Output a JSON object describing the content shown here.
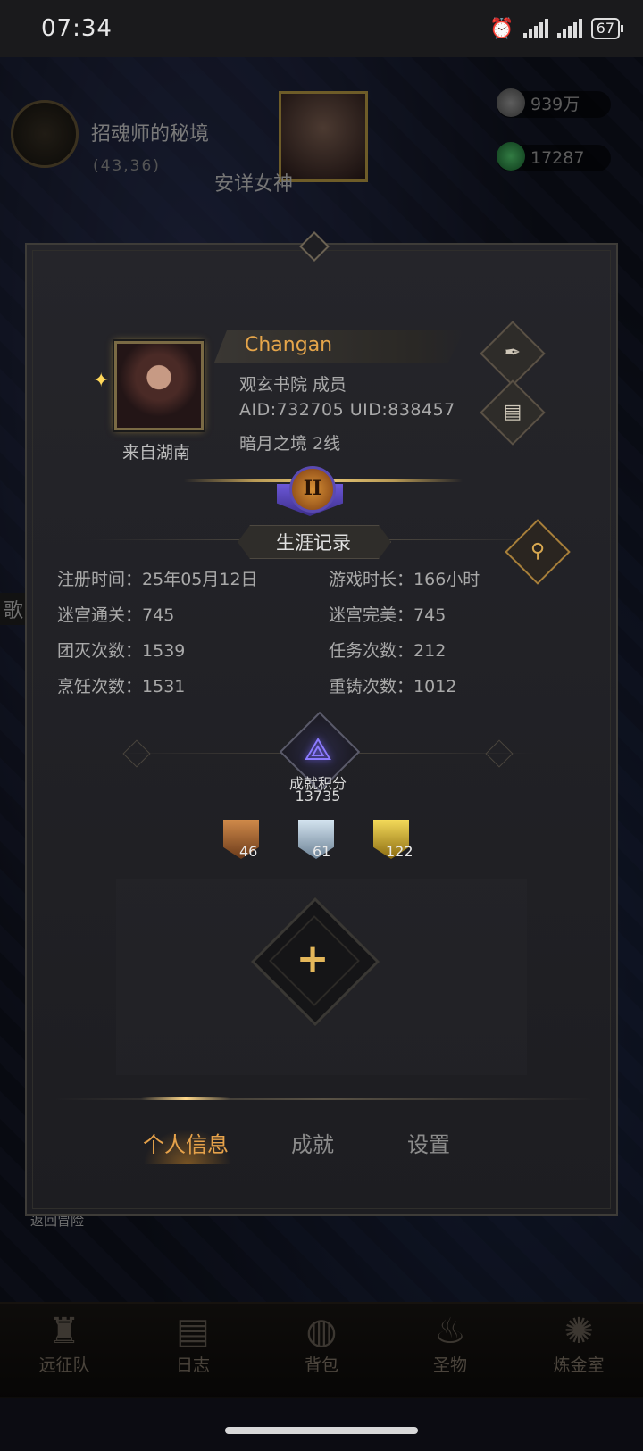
{
  "status_bar": {
    "time": "07:34",
    "battery": "67"
  },
  "background": {
    "map_name": "招魂师的秘境",
    "map_coord": "(43,36)",
    "npc_name": "安详女神",
    "currency_silver": "939万",
    "currency_gem": "17287",
    "side_text": "歌",
    "return_label": "返回冒险"
  },
  "bottom_nav": [
    {
      "label": "远征队",
      "icon": "helmet-icon"
    },
    {
      "label": "日志",
      "icon": "scroll-icon"
    },
    {
      "label": "背包",
      "icon": "bag-icon"
    },
    {
      "label": "圣物",
      "icon": "torch-icon"
    },
    {
      "label": "炼金室",
      "icon": "alchemy-icon"
    }
  ],
  "profile": {
    "name": "Changan",
    "guild": "观玄书院  成员",
    "ids": "AID:732705 UID:838457",
    "server": "暗月之境  2线",
    "origin": "来自湖南",
    "rank": "II"
  },
  "career": {
    "title": "生涯记录",
    "stats": [
      {
        "label": "注册时间：",
        "value": "25年05月12日"
      },
      {
        "label": "游戏时长：",
        "value": "166小时"
      },
      {
        "label": "迷宫通关：",
        "value": "745"
      },
      {
        "label": "迷宫完美：",
        "value": "745"
      },
      {
        "label": "团灭次数：",
        "value": "1539"
      },
      {
        "label": "任务次数：",
        "value": "212"
      },
      {
        "label": "烹饪次数：",
        "value": "1531"
      },
      {
        "label": "重铸次数：",
        "value": "1012"
      }
    ]
  },
  "achievement": {
    "label": "成就积分",
    "score": "13735",
    "medals": [
      {
        "tier": "bronze",
        "count": "46",
        "color": "#b0703a"
      },
      {
        "tier": "silver",
        "count": "61",
        "color": "#9ab4c8"
      },
      {
        "tier": "gold",
        "count": "122",
        "color": "#d8b63a"
      }
    ]
  },
  "tabs": {
    "personal": "个人信息",
    "achievements": "成就",
    "settings": "设置"
  },
  "colors": {
    "accent": "#e5a54a",
    "text_muted": "#a9a9a9",
    "panel": "#222226"
  }
}
